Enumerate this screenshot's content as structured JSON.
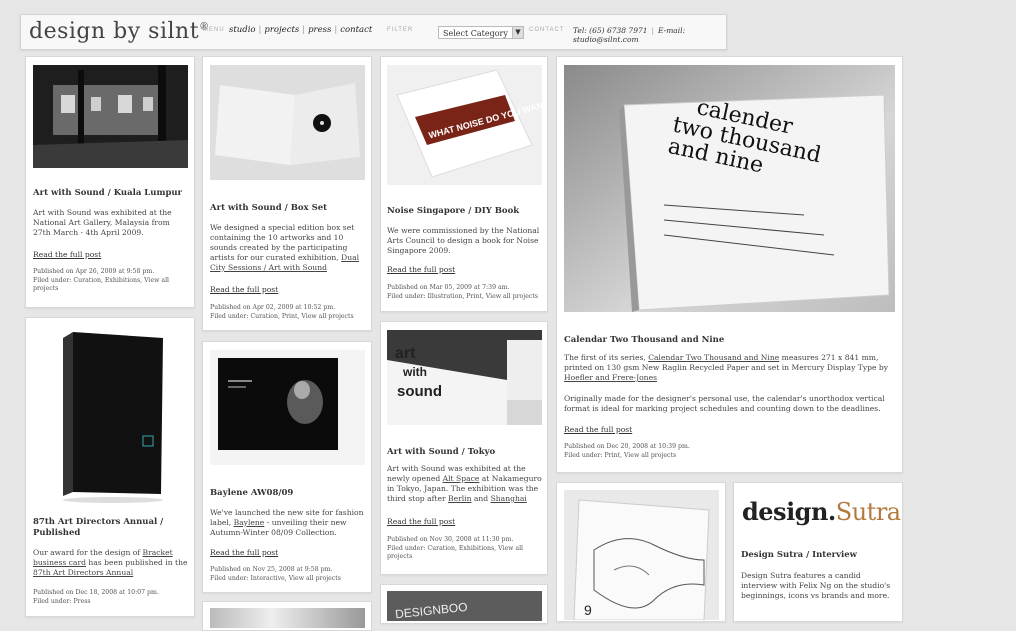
{
  "header": {
    "logo": "design by silnt",
    "logo_mark": "®",
    "menu_label": "MENU",
    "nav": [
      "studio",
      "projects",
      "press",
      "contact"
    ],
    "filter_label": "FILTER",
    "filter_value": "Select Category",
    "contact_label": "CONTACT",
    "tel": "Tel: (65) 6738 7971",
    "email": "E-mail: studio@silnt.com"
  },
  "cards": {
    "kl": {
      "title": "Art with Sound / Kuala Lumpur",
      "body": "Art with Sound was exhibited at the National Art Gallery, Malaysia from 27th March - 4th April 2009.",
      "read": "Read the full post",
      "meta1": "Published on Apr 26, 2009 at 9:58 pm.",
      "meta2": "Filed under: Curation, Exhibitions, View all projects"
    },
    "boxset": {
      "title": "Art with Sound / Box Set",
      "body1": "We designed a special edition box set containing the 10 artworks and 10 sounds created by the participating artists for our curated exhibition,",
      "body_link": "Dual City Sessions / Art with Sound",
      "read": "Read the full post",
      "meta1": "Published on Apr 02, 2009 at 10:52 pm.",
      "meta2": "Filed under: Curation, Print, View all projects"
    },
    "noise": {
      "title": "Noise Singapore / DIY Book",
      "body": "We were commissioned by the National Arts Council to design a book for Noise Singapore 2009.",
      "read": "Read the full post",
      "meta1": "Published on Mar 05, 2009 at 7:39 am.",
      "meta2": "Filed under: Illustration, Print, View all projects",
      "thumb_text": "WHAT NOISE DO YOU WANNA MAKE?"
    },
    "calendar": {
      "title": "Calendar Two Thousand and Nine",
      "body1a": "The first of its series,",
      "body1_link": "Calendar Two Thousand and Nine",
      "body1b": "measures 271 x 841 mm, printed on 130 gsm New Raglin Recycled Paper and set in Mercury Display Type by",
      "body1_link2": "Hoefler and Frere-Jones",
      "body2": "Originally made for the designer's personal use, the calendar's unorthodox vertical format is ideal for marking project schedules and counting down to the deadlines.",
      "read": "Read the full post",
      "meta1": "Published on Dec 20, 2008 at 10:39 pm.",
      "meta2": "Filed under: Print, View all projects",
      "thumb_line1": "calender",
      "thumb_line2": "two thousand",
      "thumb_line3": "and nine"
    },
    "annual": {
      "title": "87th Art Directors Annual / Published",
      "body1": "Our award for the design of",
      "body_link": "Bracket business card",
      "body2": "has been published in the",
      "body_link2": "87th Art Directors Annual",
      "meta1": "Published on Dec 18, 2008 at 10:07 pm.",
      "meta2": "Filed under: Press"
    },
    "baylene": {
      "title": "Baylene AW08/09",
      "body1": "We've launched the new site for fashion label,",
      "body_link": "Baylene",
      "body2": "- unveiling their new Autumn-Winter 08/09 Collection.",
      "read": "Read the full post",
      "meta1": "Published on Nov 25, 2008 at 9:58 pm.",
      "meta2": "Filed under: Interactive, View all projects"
    },
    "tokyo": {
      "title": "Art with Sound / Tokyo",
      "body1": "Art with Sound was exhibited at the newly opened",
      "body_link": "Alt Space",
      "body2": "at Nakameguro in Tokyo, Japan. The exhibition was the third stop after",
      "body_link2": "Berlin",
      "body3": "and",
      "body_link3": "Shanghai",
      "read": "Read the full post",
      "meta1": "Published on Nov 30, 2008 at 11:30 pm.",
      "meta2": "Filed under: Curation, Exhibitions, View all projects",
      "thumb_text1": "art",
      "thumb_text2": "with",
      "thumb_text3": "sound"
    },
    "sutra": {
      "logo_a": "design",
      "logo_b": "Sutra",
      "title": "Design Sutra / Interview",
      "body": "Design Sutra features a candid interview with Felix Ng on the studio's beginnings, icons vs brands and more."
    },
    "designbook": {
      "thumb_text": "DESIGNBOO"
    }
  },
  "colors": {
    "page_bg": "#e6e6e6",
    "card_bg": "#ffffff",
    "accent_red": "#7a2418"
  }
}
